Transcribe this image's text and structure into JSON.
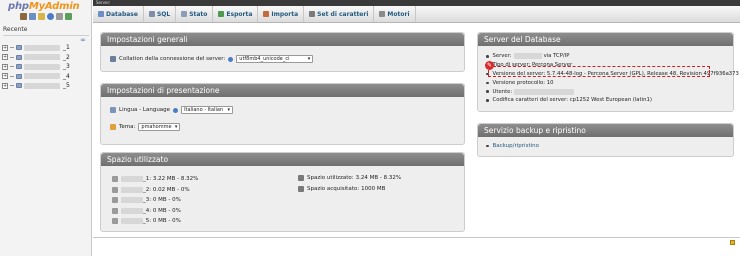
{
  "sidebar": {
    "logo_part1": "php",
    "logo_part2": "MyAdmin",
    "recent_label": "Recente",
    "tree_items": [
      {
        "label": "_1"
      },
      {
        "label": "_2"
      },
      {
        "label": "_3"
      },
      {
        "label": "_4"
      },
      {
        "label": "_5"
      }
    ]
  },
  "topbar": {
    "crumb": "Server:"
  },
  "tabs": [
    {
      "label": "Database",
      "icon": "database-icon",
      "color": "#6b8fc5"
    },
    {
      "label": "SQL",
      "icon": "sql-icon",
      "color": "#7d8ea6"
    },
    {
      "label": "Stato",
      "icon": "status-icon",
      "color": "#8c9db5"
    },
    {
      "label": "Esporta",
      "icon": "export-icon",
      "color": "#4d9a4d"
    },
    {
      "label": "Importa",
      "icon": "import-icon",
      "color": "#c46b3c"
    },
    {
      "label": "Set di caratteri",
      "icon": "charset-icon",
      "color": "#7a7a7a"
    },
    {
      "label": "Motori",
      "icon": "engines-icon",
      "color": "#8a8a8a"
    }
  ],
  "general": {
    "title": "Impostazioni generali",
    "collation_label": "Collation della connessione del server:",
    "collation_value": "utf8mb4_unicode_ci"
  },
  "presentation": {
    "title": "Impostazioni di presentazione",
    "language_label": "Lingua - Language",
    "language_value": "Italiano - Italian",
    "theme_label": "Tema:",
    "theme_value": "pmahomme"
  },
  "space": {
    "title": "Spazio utilizzato",
    "items": [
      {
        "text": "_1: 3.22 MB - 8.32%"
      },
      {
        "text": "_2: 0.02 MB - 0%"
      },
      {
        "text": "_3: 0 MB - 0%"
      },
      {
        "text": "_4: 0 MB - 0%"
      },
      {
        "text": "_5: 0 MB - 0%"
      }
    ],
    "used_label": "Spazio utilizzato:",
    "used_value": "3.24 MB - 8.32%",
    "acquired_label": "Spazio acquisitato:",
    "acquired_value": "1000 MB"
  },
  "dbserver": {
    "title": "Server del Database",
    "server_prefix": "Server:",
    "server_suffix": "via TCP/IP",
    "type": "Tipo di server: Percona Server",
    "version": "Versione del server: 5.7.44-48-log - Percona Server (GPL), Release 48, Revision 497f936a373",
    "protocol": "Versione protocollo: 10",
    "user_prefix": "Utente:",
    "charset": "Codifica caratteri del server: cp1252 West European (latin1)"
  },
  "backup": {
    "title": "Servizio backup e ripristino",
    "link": "Backup/ripristino"
  },
  "colors": {
    "panel_header": "#7a7a7a",
    "link": "#235a81",
    "highlight": "#cf2020"
  }
}
